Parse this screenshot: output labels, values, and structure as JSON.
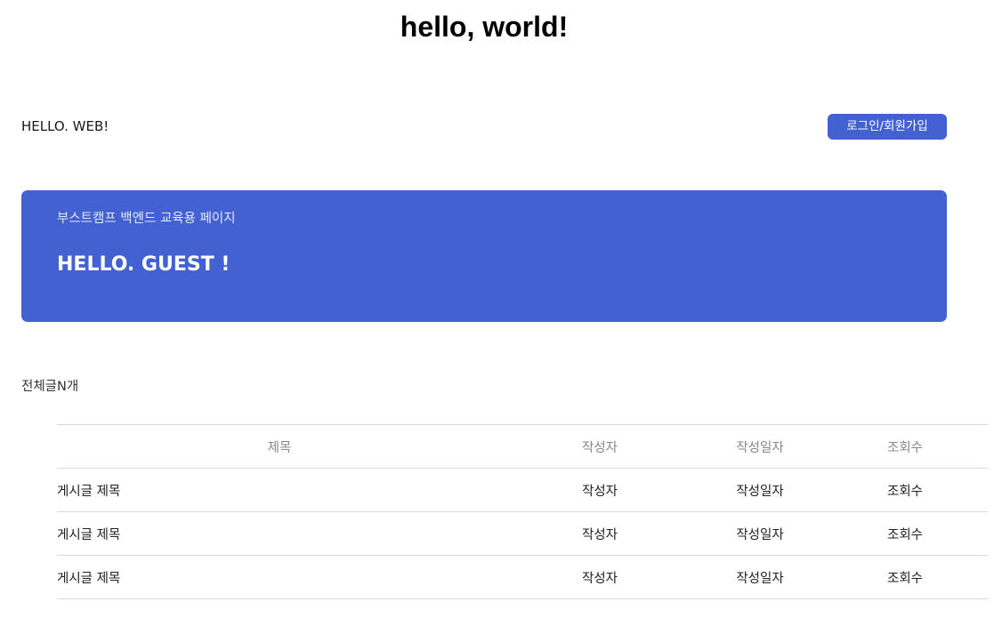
{
  "page_title": "hello, world!",
  "header": {
    "brand": "HELLO. WEB!",
    "login_label": "로그인/회원가입"
  },
  "hero": {
    "subtitle": "부스트캠프 백엔드 교육용 페이지",
    "heading": "HELLO. GUEST !"
  },
  "post_count": "전체글N개",
  "table": {
    "columns": [
      "제목",
      "작성자",
      "작성일자",
      "조회수"
    ],
    "rows": [
      [
        "게시글 제목",
        "작성자",
        "작성일자",
        "조회수"
      ],
      [
        "게시글 제목",
        "작성자",
        "작성일자",
        "조회수"
      ],
      [
        "게시글 제목",
        "작성자",
        "작성일자",
        "조회수"
      ]
    ]
  },
  "colors": {
    "accent": "#4361d0",
    "divider": "#d9d9d9"
  }
}
